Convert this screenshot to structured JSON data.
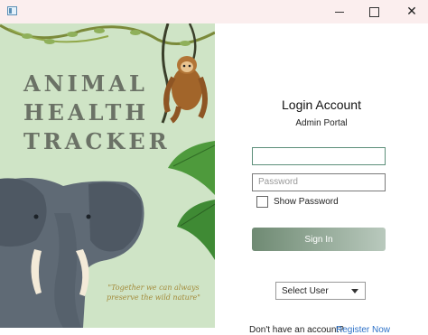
{
  "titlebar": {
    "app_icon": "window-icon",
    "minimize_icon": "minimize-icon",
    "maximize_icon": "maximize-icon",
    "close_icon": "close-icon"
  },
  "left_panel": {
    "title_line1": "ANIMAL",
    "title_line2": "HEALTH",
    "title_line3": "TRACKER",
    "quote": "\"Together we can always preserve the wild nature\""
  },
  "login": {
    "heading": "Login Account",
    "subheading": "Admin Portal",
    "username_value": "",
    "password_placeholder": "Password",
    "show_password_label": "Show Password",
    "sign_in_label": "Sign In",
    "select_user_label": "Select User",
    "no_account_text": "Don't have an account?",
    "register_label": "Register Now"
  },
  "colors": {
    "panel_bg": "#cfe4c6",
    "accent_link": "#2e72c8",
    "button_gradient_start": "#6f8a73",
    "button_gradient_end": "#b9c9bd",
    "titlebar_bg": "#fbeeee"
  }
}
